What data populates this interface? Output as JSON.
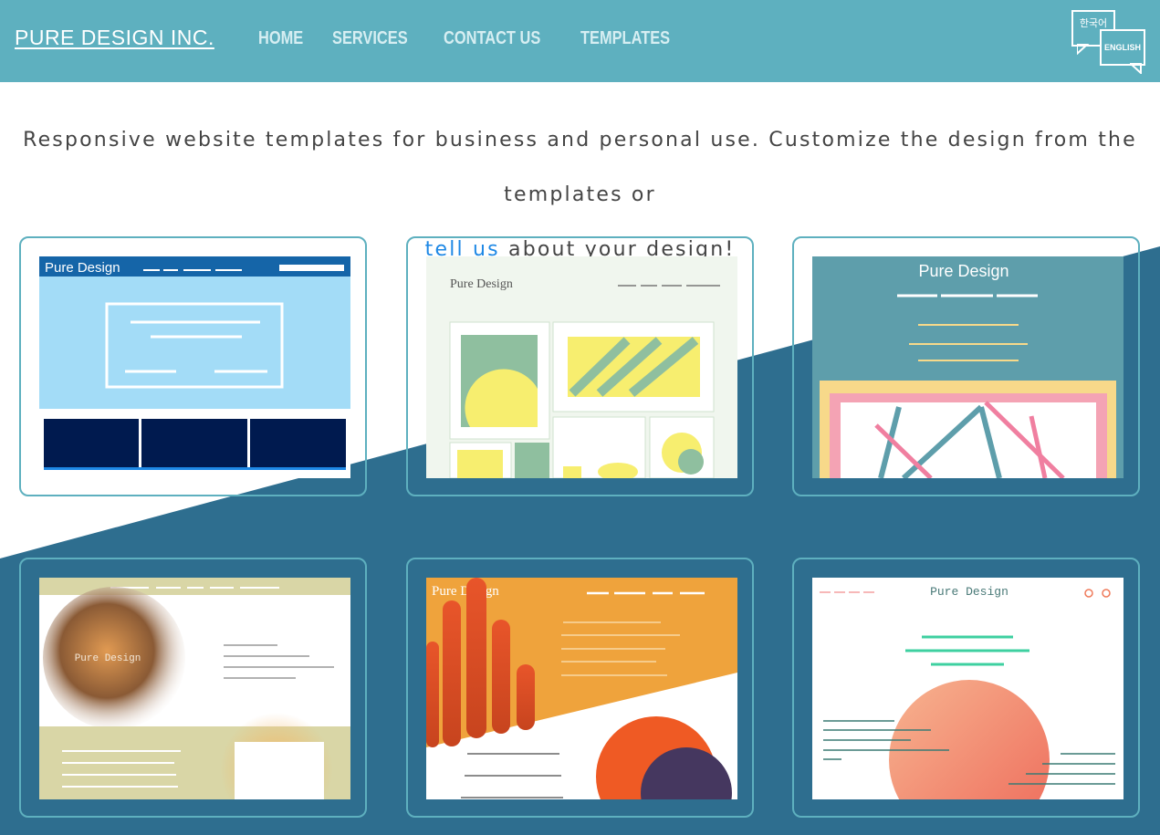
{
  "header": {
    "brand": "PURE DESIGN INC.",
    "nav": [
      "HOME",
      "SERVICES",
      "CONTACT US",
      "TEMPLATES"
    ],
    "lang": {
      "korean": "한국어",
      "english": "ENGLISH"
    }
  },
  "intro": {
    "line1": "Responsive website templates for business and personal use. Customize the design from the templates or",
    "link": "tell us",
    "line2": " about your design!"
  },
  "templates": [
    {
      "brand": "Pure Design"
    },
    {
      "brand": "Pure Design"
    },
    {
      "brand": "Pure Design"
    },
    {
      "brand": "Pure Design"
    },
    {
      "brand": "Pure Design"
    },
    {
      "brand": "Pure Design"
    }
  ],
  "colors": {
    "header": "#5eb0bf",
    "navy": "#2e6e8f",
    "link": "#1e88e5",
    "card_border": "#5eb0bf"
  }
}
